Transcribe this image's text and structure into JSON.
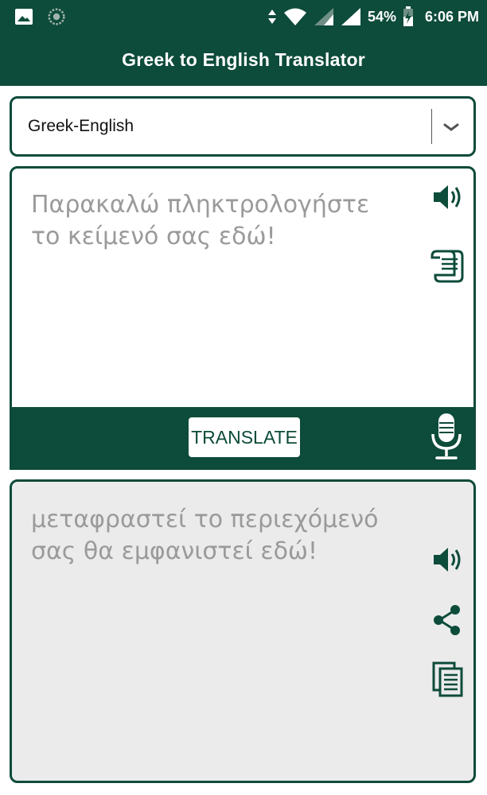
{
  "status_bar": {
    "battery": "54%",
    "time": "6:06 PM",
    "icons": [
      "gallery-icon",
      "sync-icon",
      "data-arrows-icon",
      "wifi-icon",
      "signal-icon",
      "signal-icon-2",
      "battery-icon"
    ]
  },
  "app_bar": {
    "title": "Greek to English Translator"
  },
  "language_selector": {
    "selected": "Greek-English"
  },
  "input": {
    "placeholder": "Παρακαλώ πληκτρολογήστε το κείμενό σας εδώ!",
    "icons": [
      "speaker-icon",
      "scroll-icon"
    ]
  },
  "translate_button": {
    "label": "TRANSLATE"
  },
  "output": {
    "placeholder": "μεταφραστεί το περιεχόμενό σας θα εμφανιστεί εδώ!",
    "icons": [
      "speaker-icon",
      "share-icon",
      "copy-icon"
    ]
  },
  "colors": {
    "primary": "#0d4b3a",
    "output_bg": "#ebebeb",
    "placeholder": "#9a9a9a"
  }
}
